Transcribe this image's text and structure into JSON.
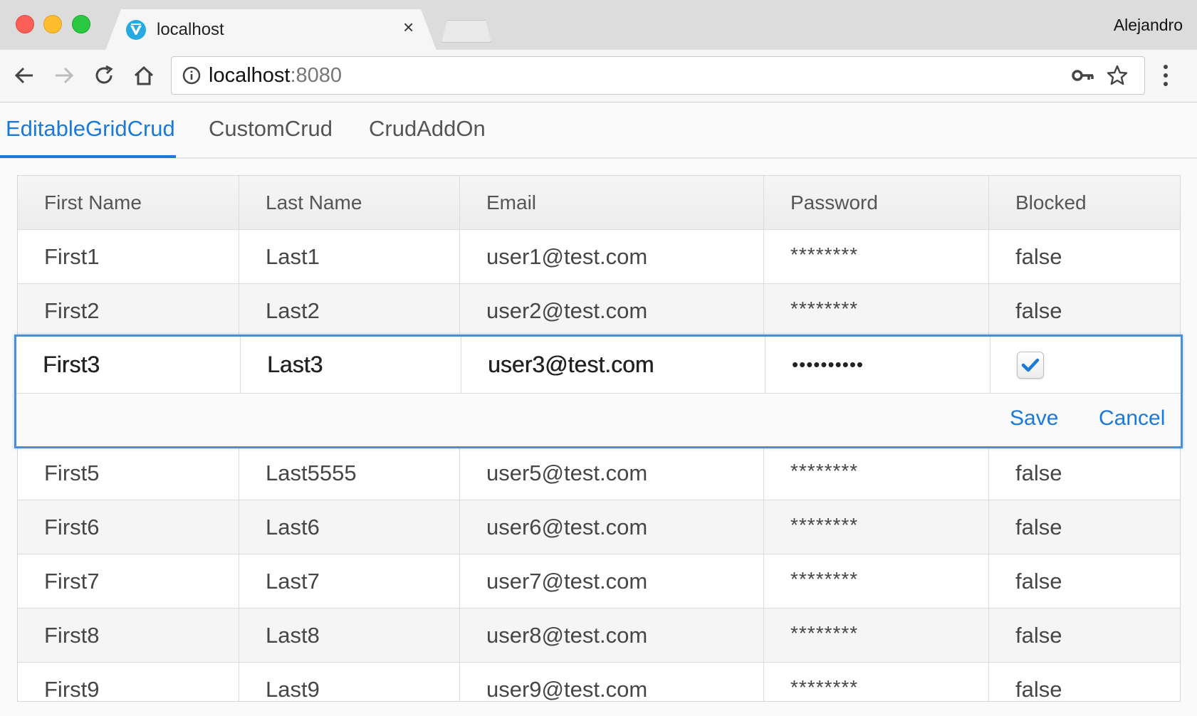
{
  "browser": {
    "tab_title": "localhost",
    "tab_close_glyph": "×",
    "profile_name": "Alejandro",
    "url_host": "localhost",
    "url_port": ":8080",
    "icons": [
      "back-arrow-icon",
      "forward-arrow-icon",
      "reload-icon",
      "home-icon",
      "info-icon",
      "key-icon",
      "star-icon",
      "more-vert-icon"
    ]
  },
  "app_tabs": [
    {
      "label": "EditableGridCrud",
      "active": true
    },
    {
      "label": "CustomCrud",
      "active": false
    },
    {
      "label": "CrudAddOn",
      "active": false
    }
  ],
  "grid": {
    "columns": [
      "First Name",
      "Last Name",
      "Email",
      "Password",
      "Blocked"
    ],
    "rows_top": [
      {
        "first": "First1",
        "last": "Last1",
        "email": "user1@test.com",
        "password": "********",
        "blocked": "false"
      },
      {
        "first": "First2",
        "last": "Last2",
        "email": "user2@test.com",
        "password": "********",
        "blocked": "false"
      }
    ],
    "editor": {
      "first": "First3",
      "last": "Last3",
      "email": "user3@test.com",
      "password": "••••••••••",
      "blocked_checked": true,
      "save_label": "Save",
      "cancel_label": "Cancel"
    },
    "rows_bottom": [
      {
        "first": "First5",
        "last": "Last5555",
        "email": "user5@test.com",
        "password": "********",
        "blocked": "false"
      },
      {
        "first": "First6",
        "last": "Last6",
        "email": "user6@test.com",
        "password": "********",
        "blocked": "false"
      },
      {
        "first": "First7",
        "last": "Last7",
        "email": "user7@test.com",
        "password": "********",
        "blocked": "false"
      },
      {
        "first": "First8",
        "last": "Last8",
        "email": "user8@test.com",
        "password": "********",
        "blocked": "false"
      },
      {
        "first": "First9",
        "last": "Last9",
        "email": "user9@test.com",
        "password": "********",
        "blocked": "false"
      }
    ]
  },
  "colors": {
    "accent": "#1b79d8",
    "editor_border": "#4a90d9"
  }
}
